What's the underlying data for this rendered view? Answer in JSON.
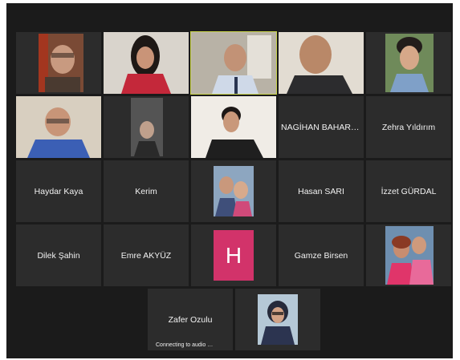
{
  "participants": [
    {
      "name": "",
      "kind": "video"
    },
    {
      "name": "",
      "kind": "video"
    },
    {
      "name": "",
      "kind": "video",
      "speaking": true
    },
    {
      "name": "",
      "kind": "video"
    },
    {
      "name": "",
      "kind": "video"
    },
    {
      "name": "",
      "kind": "video"
    },
    {
      "name": "",
      "kind": "video"
    },
    {
      "name": "",
      "kind": "video"
    },
    {
      "name": "NAGİHAN BAHAR K...",
      "kind": "name"
    },
    {
      "name": "Zehra Yıldırım",
      "kind": "name"
    },
    {
      "name": "Haydar Kaya",
      "kind": "name"
    },
    {
      "name": "Kerim",
      "kind": "name"
    },
    {
      "name": "",
      "kind": "photo"
    },
    {
      "name": "Hasan SARI",
      "kind": "name"
    },
    {
      "name": "İzzet GÜRDAL",
      "kind": "name"
    },
    {
      "name": "Dilek Şahin",
      "kind": "name"
    },
    {
      "name": "Emre AKYÜZ",
      "kind": "name"
    },
    {
      "name": "",
      "kind": "avatar",
      "initial": "H",
      "color": "#d2336a"
    },
    {
      "name": "Gamze Birsen",
      "kind": "name"
    },
    {
      "name": "",
      "kind": "photo"
    },
    {
      "name": "Zafer Ozulu",
      "kind": "name"
    },
    {
      "name": "",
      "kind": "photo"
    }
  ],
  "status_text": "Connecting to audio …",
  "colors": {
    "background": "#1b1b1b",
    "tile": "#2c2c2c",
    "active_border": "#c9d34a",
    "avatar": "#d2336a"
  }
}
